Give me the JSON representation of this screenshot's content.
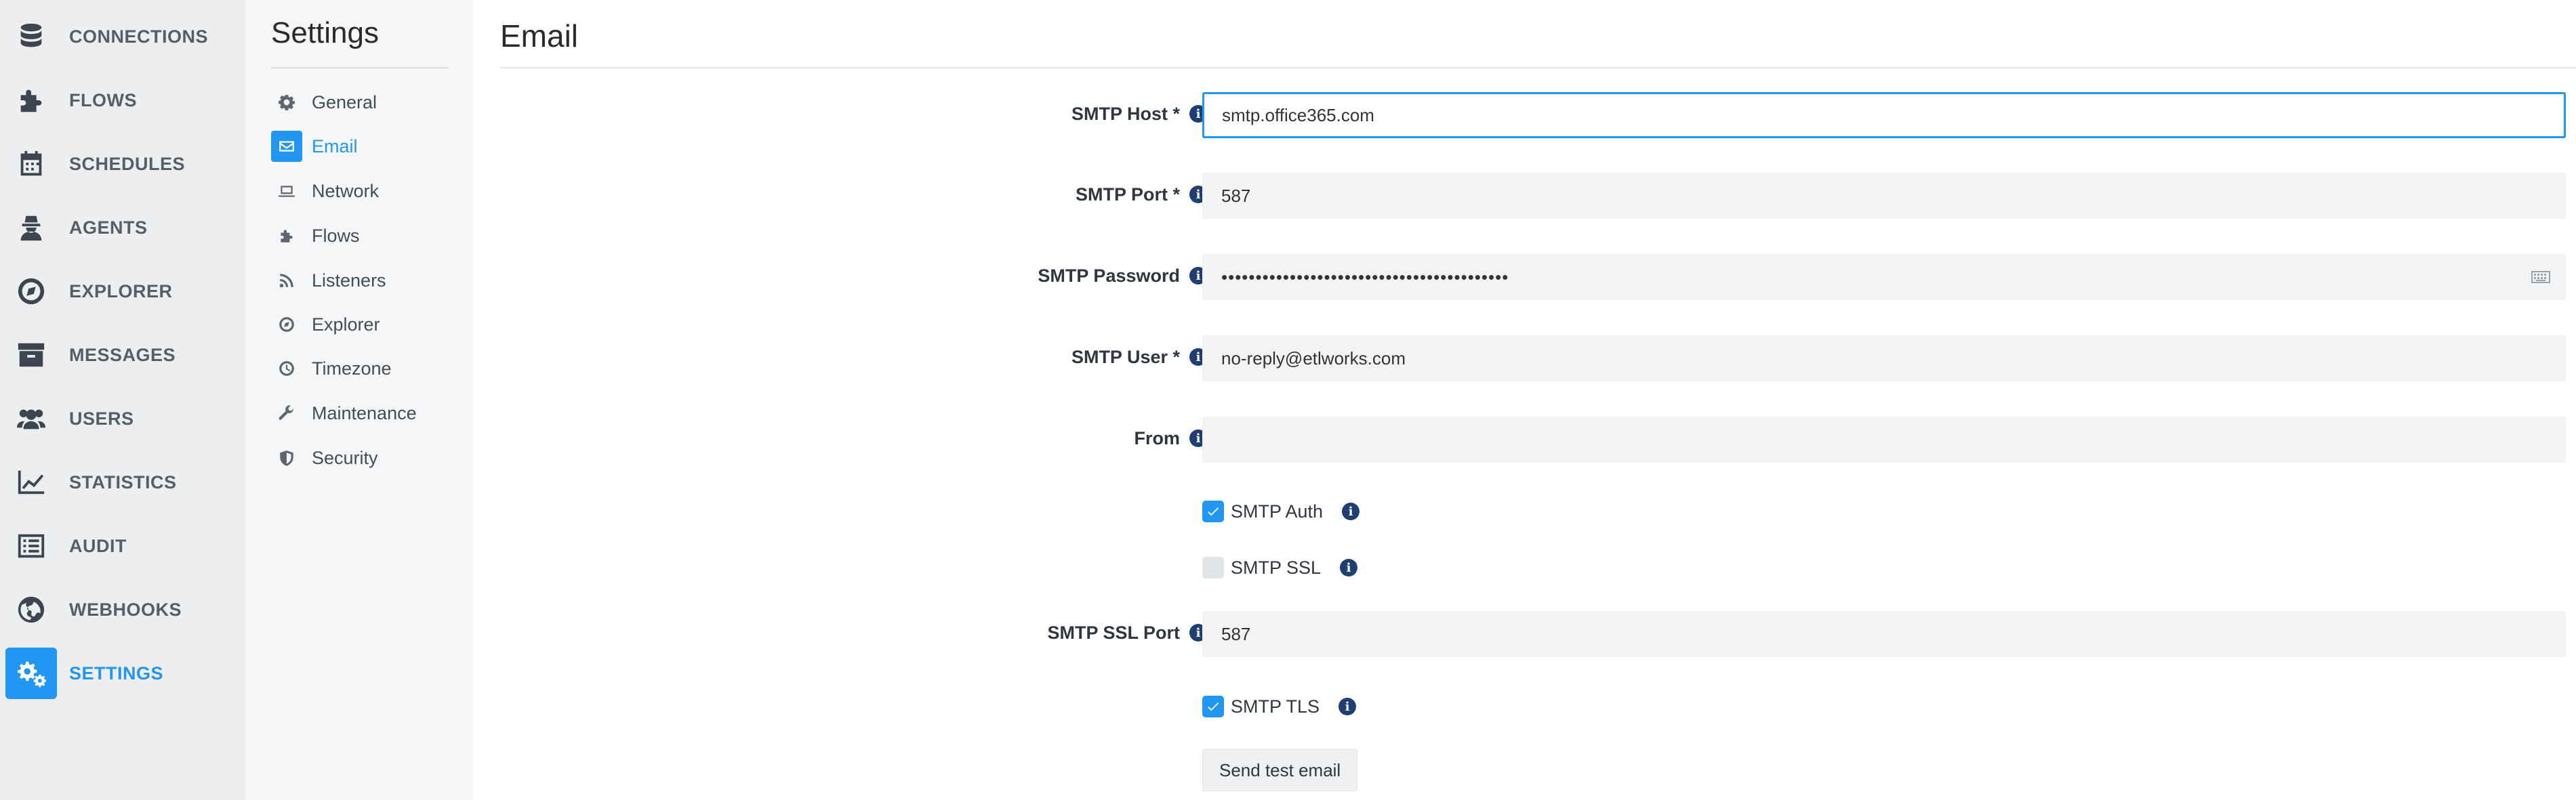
{
  "nav": {
    "items": [
      {
        "label": "CONNECTIONS",
        "icon": "database-icon"
      },
      {
        "label": "FLOWS",
        "icon": "puzzle-icon"
      },
      {
        "label": "SCHEDULES",
        "icon": "calendar-icon"
      },
      {
        "label": "AGENTS",
        "icon": "agent-icon"
      },
      {
        "label": "EXPLORER",
        "icon": "compass-icon"
      },
      {
        "label": "MESSAGES",
        "icon": "archive-icon"
      },
      {
        "label": "USERS",
        "icon": "users-icon"
      },
      {
        "label": "STATISTICS",
        "icon": "chart-line-icon"
      },
      {
        "label": "AUDIT",
        "icon": "list-icon"
      },
      {
        "label": "WEBHOOKS",
        "icon": "globe-icon"
      },
      {
        "label": "SETTINGS",
        "icon": "cogs-icon",
        "active": true
      }
    ]
  },
  "settings_menu": {
    "title": "Settings",
    "items": [
      {
        "label": "General",
        "icon": "gear-icon"
      },
      {
        "label": "Email",
        "icon": "envelope-icon",
        "active": true
      },
      {
        "label": "Network",
        "icon": "laptop-icon"
      },
      {
        "label": "Flows",
        "icon": "puzzle-icon"
      },
      {
        "label": "Listeners",
        "icon": "rss-icon"
      },
      {
        "label": "Explorer",
        "icon": "compass-icon"
      },
      {
        "label": "Timezone",
        "icon": "clock-icon"
      },
      {
        "label": "Maintenance",
        "icon": "wrench-icon"
      },
      {
        "label": "Security",
        "icon": "shield-icon"
      }
    ]
  },
  "page": {
    "title": "Email"
  },
  "form": {
    "smtp_host": {
      "label": "SMTP Host *",
      "value": "smtp.office365.com"
    },
    "smtp_port": {
      "label": "SMTP Port *",
      "value": "587"
    },
    "smtp_password": {
      "label": "SMTP Password",
      "value": "••••••••••••••••••••••••••••••••••••••••••"
    },
    "smtp_user": {
      "label": "SMTP User *",
      "value": "no-reply@etlworks.com"
    },
    "from": {
      "label": "From",
      "value": ""
    },
    "smtp_auth": {
      "label": "SMTP Auth",
      "checked": true
    },
    "smtp_ssl": {
      "label": "SMTP SSL",
      "checked": false
    },
    "smtp_ssl_port": {
      "label": "SMTP SSL Port",
      "value": "587"
    },
    "smtp_tls": {
      "label": "SMTP TLS",
      "checked": true
    },
    "send_test_label": "Send test email"
  },
  "colors": {
    "accent": "#2196f3",
    "info": "#1f3f73",
    "nav_bg": "#eceef0",
    "submenu_bg": "#f5f6f7"
  }
}
